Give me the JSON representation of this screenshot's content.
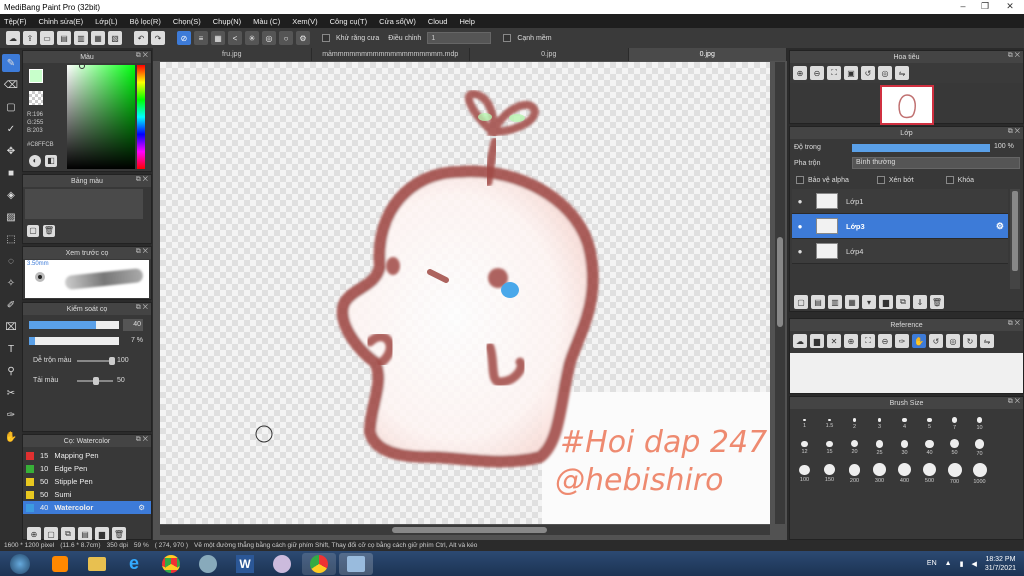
{
  "window": {
    "title": "MediBang Paint Pro (32bit)"
  },
  "menu": [
    "Tệp(F)",
    "Chỉnh sửa(E)",
    "Lớp(L)",
    "Bộ lọc(R)",
    "Chọn(S)",
    "Chụp(N)",
    "Màu (C)",
    "Xem(V)",
    "Công cụ(T)",
    "Cửa sổ(W)",
    "Cloud",
    "Help"
  ],
  "toolbar": {
    "antialias": "Khử răng cưa",
    "adjust_label": "Điều chỉnh",
    "adjust_value": "1",
    "snap_label": "Cạnh mềm"
  },
  "tabs": [
    "fru.jpg",
    "mảmmmmmmmmmmmmmmmmmmm.mdp",
    "0.jpg",
    "0.jpg"
  ],
  "color_panel": {
    "title": "Màu",
    "r": "R:196",
    "g": "G:255",
    "b": "B:203",
    "hex": "#C8FFCB",
    "fg": "#c8ffcb",
    "bg": "#e0473f"
  },
  "palette_panel": {
    "title": "Bảng màu"
  },
  "preview_panel": {
    "title": "Xem trước cọ",
    "size": "3.50mm"
  },
  "brush_ctrl": {
    "title": "Kiểm soát cọ",
    "size_value": "40",
    "opacity_value": "7 %",
    "blend_label": "Dễ trộn màu",
    "blend_value": "100",
    "refill_label": "Tải màu",
    "refill_value": "50"
  },
  "brush_list": {
    "title": "Cọ: Watercolor",
    "items": [
      {
        "size": "15",
        "name": "Mapping Pen",
        "color": "#e03030"
      },
      {
        "size": "10",
        "name": "Edge Pen",
        "color": "#38b038"
      },
      {
        "size": "50",
        "name": "Stipple Pen",
        "color": "#e8c820"
      },
      {
        "size": "50",
        "name": "Sumi",
        "color": "#e8c820"
      },
      {
        "size": "40",
        "name": "Watercolor",
        "color": "#3d9be0"
      }
    ]
  },
  "navigator": {
    "title": "Hoa tiêu"
  },
  "layer_panel": {
    "title": "Lớp",
    "opacity_label": "Độ trong",
    "opacity_value": "100 %",
    "blend_label": "Pha trộn",
    "blend_value": "Bình thường",
    "protect": "Bảo vệ alpha",
    "clip": "Xén bớt",
    "lock": "Khóa",
    "layers": [
      "Lớp1",
      "Lớp3",
      "Lớp4"
    ]
  },
  "reference": {
    "title": "Reference"
  },
  "brush_size": {
    "title": "Brush Size",
    "sizes": [
      "1",
      "1.5",
      "2",
      "3",
      "4",
      "5",
      "7",
      "10",
      "12",
      "15",
      "20",
      "25",
      "30",
      "40",
      "50",
      "70",
      "100",
      "150",
      "200",
      "300",
      "400",
      "500",
      "700",
      "1000"
    ]
  },
  "canvas_text": {
    "line1": "#Hoi dap 247",
    "line2": "@hebishiro"
  },
  "status": {
    "dims": "1600 * 1200 pixel",
    "size_cm": "(11.6 * 8.7cm)",
    "dpi": "350 dpi",
    "zoom": "59 %",
    "coords": "( 274, 970 )",
    "hint": "Vẽ một đường thẳng bằng cách giữ phím Shift, Thay đổi cỡ cọ bằng cách giữ phím Ctrl, Alt và kéo"
  },
  "tray": {
    "lang": "EN",
    "time": "18:32 PM",
    "date": "31/7/2021"
  }
}
